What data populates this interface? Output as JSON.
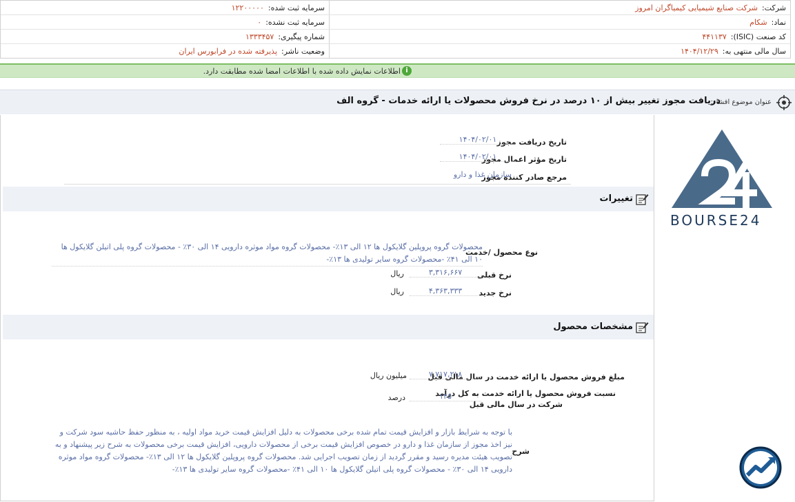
{
  "header": {
    "company_label": "شرکت:",
    "company_value": "شرکت صنایع شیمیایی کیمیاگران امروز",
    "registered_capital_label": "سرمایه ثبت شده:",
    "registered_capital_value": "۱۲۲۰۰۰۰۰",
    "symbol_label": "نماد:",
    "symbol_value": "شکام",
    "unregistered_capital_label": "سرمایه ثبت نشده:",
    "unregistered_capital_value": "۰",
    "isic_label": "کد صنعت (ISIC):",
    "isic_value": "۴۴۱۱۳۷",
    "tracking_label": "شماره پیگیری:",
    "tracking_value": "۱۳۳۳۴۵۷",
    "fiscal_year_label": "سال مالی منتهی به:",
    "fiscal_year_value": "۱۴۰۴/۱۲/۲۹",
    "publisher_status_label": "وضعیت ناشر:",
    "publisher_status_value": "پذیرفته شده در فرابورس ایران"
  },
  "alert": {
    "text": "اطلاعات نمایش داده شده با اطلاعات امضا شده مطابقت دارد.",
    "icon": "info-icon",
    "color": "#cfe8c4"
  },
  "disclosure": {
    "subject_label": "عنوان موضوع افشاء:",
    "subject": "دریافت مجوز تغییر بیش از ۱۰ درصد در نرخ فروش محصولات یا ارائه خدمات - گروه الف"
  },
  "license": {
    "receive_date_label": "تاریخ دریافت مجوز",
    "receive_date_value": "۱۴۰۴/۰۲/۰۱",
    "effective_date_label": "تاریخ مؤثر اعمال مجوز",
    "effective_date_value": "۱۴۰۴/۰۲/۰۱",
    "issuer_label": "مرجع صادر کننده مجوز",
    "issuer_value": "سازمان غذا و دارو"
  },
  "changes": {
    "section_title": "تغییرات",
    "product_label": "نوع محصول /خدمت",
    "product_value": "محصولات گروه پروپلین گلایکول ها ۱۲ الی ۱۳٪- محصولات گروه مواد موثره دارویی ۱۴ الی ۳۰٪ - محصولات گروه پلی اتیلن گلایکول ها ۱۰ الی ۴۱٪ -محصولات گروه سایر تولیدی ها ۱۳٪-",
    "old_rate_label": "نرخ قبلی",
    "old_rate_value": "۳,۳۱۶,۶۶۷",
    "old_rate_unit": "ریال",
    "new_rate_label": "نرخ جدید",
    "new_rate_value": "۴,۳۶۳,۳۳۳",
    "new_rate_unit": "ریال"
  },
  "product_specs": {
    "section_title": "مشخصات محصول",
    "sales_label": "مبلغ فروش محصول یا ارائه خدمت در سال مالی قبل",
    "sales_value": "۷,۷۱۷,۲۱۸",
    "sales_unit": "میلیون ریال",
    "ratio_label_line1": "نسبت فروش محصول یا ارائه خدمت به کل درآمد",
    "ratio_label_line2": "شرکت در سال مالی قبل",
    "ratio_value": "۱۴۵",
    "ratio_unit": "درصد",
    "description_label": "شرح",
    "description": "با توجه به شرایط بازار و افزایش قیمت تمام شده برخی محصولات به دلیل افزایش قیمت خرید مواد اولیه ، به منظور حفظ حاشیه سود شرکت و نیز اخذ مجوز از سازمان غذا و دارو در خصوص افزایش قیمت برخی از محصولات دارویی، افزایش قیمت برخی محصولات به شرح زیر پیشنهاد و به تصویب هیئت مدیره رسید و مقرر گردید از زمان تصویب اجرایی شد. محصولات گروه پروپلین گلایکول ها ۱۲ الی ۱۳٪- محصولات گروه مواد موثره دارویی ۱۴ الی ۳۰٪ - محصولات گروه پلی اتیلن گلایکول ها ۱۰ الی ۴۱٪ -محصولات گروه سایر تولیدی ها ۱۳٪-"
  },
  "branding": {
    "logo_text": "BOURSE24",
    "logo_color": "#4a6a8a",
    "badge_icon": "trend-chart-icon"
  }
}
